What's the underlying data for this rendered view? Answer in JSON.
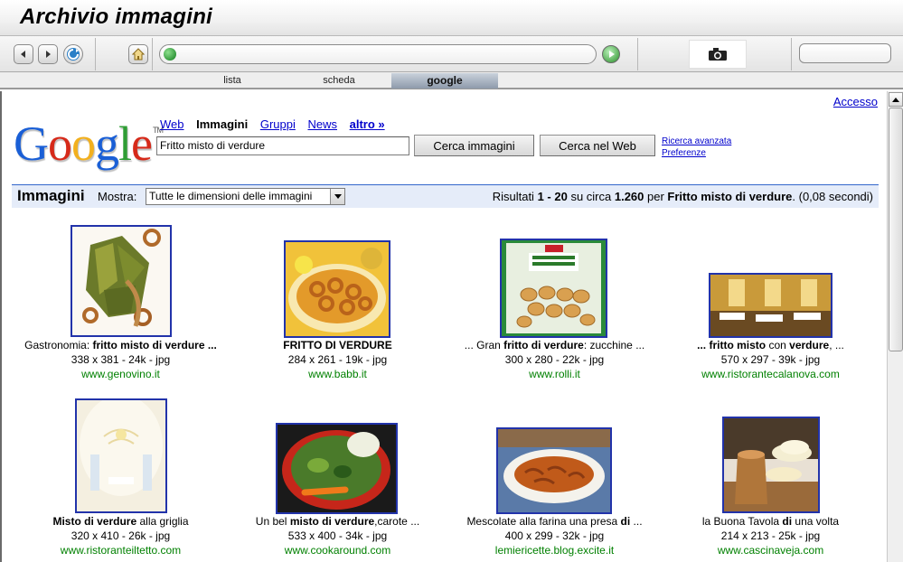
{
  "window": {
    "title": "Archivio immagini"
  },
  "tabs": [
    {
      "label": "lista"
    },
    {
      "label": "scheda"
    },
    {
      "label": "google"
    }
  ],
  "accent_colors": {
    "tab_active": "#8e9aab",
    "link": "#0000cc",
    "site_green": "#008000",
    "result_bar": "#e5ecf9"
  },
  "google": {
    "accesso": "Accesso",
    "logo_letters": [
      "G",
      "o",
      "o",
      "g",
      "l",
      "e"
    ],
    "logo_colors": [
      "#1a5fd6",
      "#d62a1a",
      "#f2b01e",
      "#1a5fd6",
      "#2f9d34",
      "#d62a1a"
    ],
    "tm": "TM",
    "nav": {
      "web": "Web",
      "immagini": "Immagini",
      "gruppi": "Gruppi",
      "news": "News",
      "altro": "altro »"
    },
    "query": "Fritto misto di verdure",
    "btn_images": "Cerca immagini",
    "btn_web": "Cerca nel Web",
    "link_advanced": "Ricerca avanzata",
    "link_prefs": "Preferenze",
    "bar_title": "Immagini",
    "mostra_label": "Mostra:",
    "size_select": "Tutte le dimensioni delle immagini",
    "stats": {
      "prefix": "Risultati",
      "range_start": "1",
      "range_sep": " - ",
      "range_end": "20",
      "mid": " su circa ",
      "total": "1.260",
      "per": " per ",
      "query": "Fritto misto di verdure",
      "time": ". (0,08 secondi)"
    }
  },
  "results": [
    {
      "cap_pre": "Gastronomia: ",
      "cap_bold": "fritto misto di verdure ...",
      "cap_post": "",
      "meta": "338 x 381 - 24k - jpg",
      "site": "www.genovino.it"
    },
    {
      "cap_pre": "",
      "cap_bold": "FRITTO DI VERDURE",
      "cap_post": "",
      "meta": "284 x 261 - 19k - jpg",
      "site": "www.babb.it"
    },
    {
      "cap_pre": "... Gran ",
      "cap_bold": "fritto di verdure",
      "cap_post": ": zucchine ...",
      "meta": "300 x 280 - 22k - jpg",
      "site": "www.rolli.it"
    },
    {
      "cap_pre": "",
      "cap_bold": "... fritto misto",
      "cap_post": " con ",
      "cap_bold2": "verdure",
      "cap_post2": ", ...",
      "meta": "570 x 297 - 39k - jpg",
      "site": "www.ristorantecalanova.com"
    },
    {
      "cap_pre": "",
      "cap_bold": "Misto di verdure",
      "cap_post": " alla griglia",
      "meta": "320 x 410 - 26k - jpg",
      "site": "www.ristoranteiltetto.com"
    },
    {
      "cap_pre": "Un bel ",
      "cap_bold": "misto di verdure",
      "cap_post": ",carote ...",
      "meta": "533 x 400 - 34k - jpg",
      "site": "www.cookaround.com"
    },
    {
      "cap_pre": "Mescolate alla farina una presa ",
      "cap_bold": "di",
      "cap_post": " ...",
      "meta": "400 x 299 - 32k - jpg",
      "site": "lemiericette.blog.excite.it"
    },
    {
      "cap_pre": "la Buona Tavola ",
      "cap_bold": "di",
      "cap_post": " una volta",
      "meta": "214 x 213 - 25k - jpg",
      "site": "www.cascinaveja.com"
    }
  ]
}
